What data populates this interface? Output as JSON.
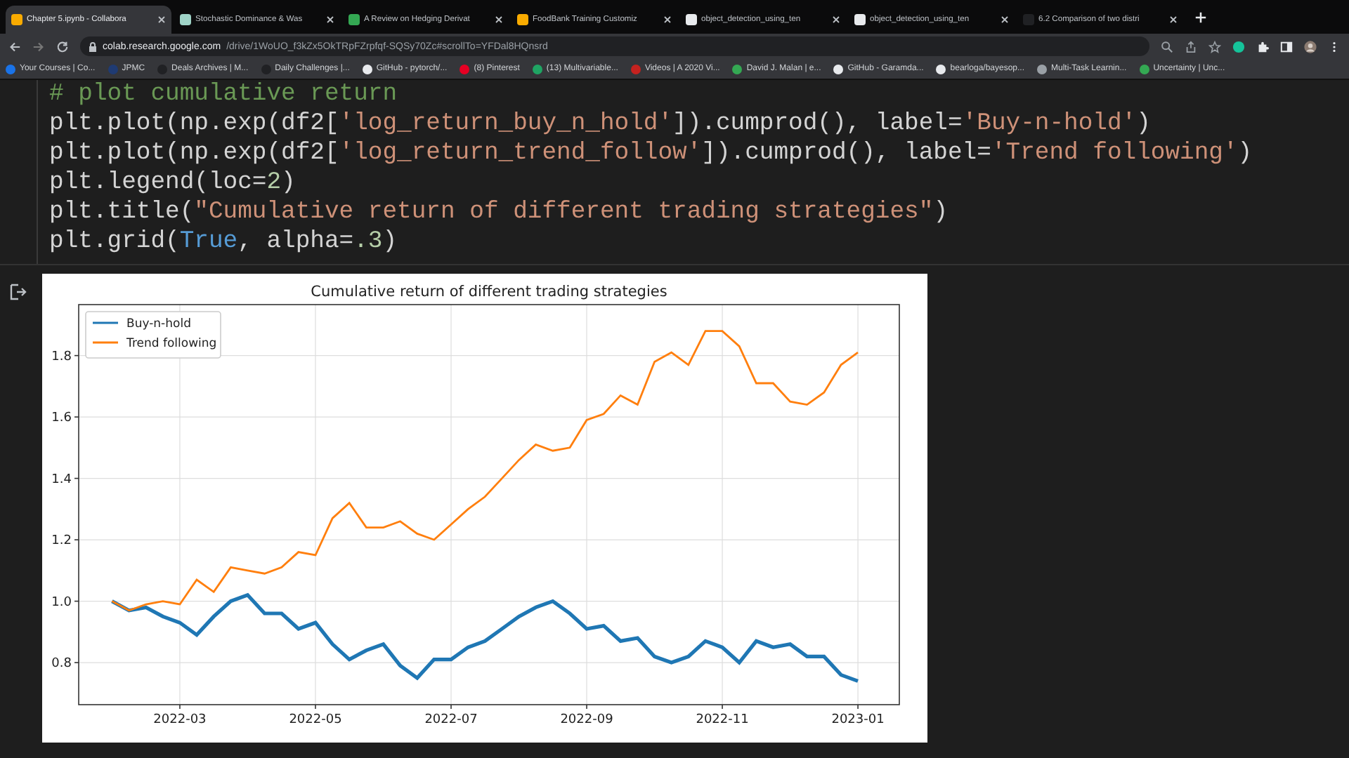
{
  "tabs": [
    {
      "title": "Chapter 5.ipynb - Collabora",
      "selected": true,
      "color": "#f9ab00"
    },
    {
      "title": "Stochastic Dominance & Was",
      "selected": false,
      "color": "#9fd3c7"
    },
    {
      "title": "A Review on Hedging Derivat",
      "selected": false,
      "color": "#34a853"
    },
    {
      "title": "FoodBank Training Customiz",
      "selected": false,
      "color": "#f9ab00"
    },
    {
      "title": "object_detection_using_ten",
      "selected": false,
      "color": "#e8eaed"
    },
    {
      "title": "object_detection_using_ten",
      "selected": false,
      "color": "#e8eaed"
    },
    {
      "title": "6.2 Comparison of two distri",
      "selected": false,
      "color": "#202124"
    }
  ],
  "address": {
    "host": "colab.research.google.com",
    "path": "/drive/1WoUO_f3kZx5OkTRpFZrpfqf-SQSy70Zc#scrollTo=YFDal8HQnsrd"
  },
  "bookmarks": [
    {
      "label": "Your Courses | Co...",
      "color": "#1a73e8"
    },
    {
      "label": "JPMC",
      "color": "#1f3b73"
    },
    {
      "label": "Deals Archives | M...",
      "color": "#202124"
    },
    {
      "label": "Daily Challenges |...",
      "color": "#202124"
    },
    {
      "label": "GitHub - pytorch/...",
      "color": "#e8eaed"
    },
    {
      "label": "(8) Pinterest",
      "color": "#e60023"
    },
    {
      "label": "(13) Multivariable...",
      "color": "#1fa463"
    },
    {
      "label": "Videos | A 2020 Vi...",
      "color": "#c5221f"
    },
    {
      "label": "David J. Malan | e...",
      "color": "#34a853"
    },
    {
      "label": "GitHub - Garamda...",
      "color": "#e8eaed"
    },
    {
      "label": "bearloga/bayesop...",
      "color": "#e8eaed"
    },
    {
      "label": "Multi-Task Learnin...",
      "color": "#9aa0a6"
    },
    {
      "label": "Uncertainty | Unc...",
      "color": "#34a853"
    }
  ],
  "code_lines": [
    [
      {
        "kind": "comment",
        "text": "# plot cumulative return"
      }
    ],
    [
      {
        "kind": "plain",
        "text": "plt.plot(np.exp(df2["
      },
      {
        "kind": "string",
        "text": "'log_return_buy_n_hold'"
      },
      {
        "kind": "plain",
        "text": "]).cumprod(), label="
      },
      {
        "kind": "string",
        "text": "'Buy-n-hold'"
      },
      {
        "kind": "plain",
        "text": ")"
      }
    ],
    [
      {
        "kind": "plain",
        "text": "plt.plot(np.exp(df2["
      },
      {
        "kind": "string",
        "text": "'log_return_trend_follow'"
      },
      {
        "kind": "plain",
        "text": "]).cumprod(), label="
      },
      {
        "kind": "string",
        "text": "'Trend following'"
      },
      {
        "kind": "plain",
        "text": ")"
      }
    ],
    [
      {
        "kind": "plain",
        "text": "plt.legend(loc="
      },
      {
        "kind": "number",
        "text": "2"
      },
      {
        "kind": "plain",
        "text": ")"
      }
    ],
    [
      {
        "kind": "plain",
        "text": "plt.title("
      },
      {
        "kind": "string",
        "text": "\"Cumulative return of different trading strategies\""
      },
      {
        "kind": "plain",
        "text": ")"
      }
    ],
    [
      {
        "kind": "plain",
        "text": "plt.grid("
      },
      {
        "kind": "keyword",
        "text": "True"
      },
      {
        "kind": "plain",
        "text": ", alpha="
      },
      {
        "kind": "number",
        "text": ".3"
      },
      {
        "kind": "plain",
        "text": ")"
      }
    ]
  ],
  "chart_data": {
    "type": "line",
    "title": "Cumulative return of different trading strategies",
    "categories": [
      null,
      null,
      null,
      null,
      "2022-03",
      null,
      null,
      null,
      null,
      null,
      null,
      null,
      "2022-05",
      null,
      null,
      null,
      null,
      null,
      null,
      null,
      "2022-07",
      null,
      null,
      null,
      null,
      null,
      null,
      null,
      "2022-09",
      null,
      null,
      null,
      null,
      null,
      null,
      null,
      "2022-11",
      null,
      null,
      null,
      null,
      null,
      null,
      null,
      "2023-01"
    ],
    "series": [
      {
        "name": "Buy-n-hold",
        "color": "#1f77b4",
        "values": [
          1.0,
          0.97,
          0.98,
          0.95,
          0.93,
          0.89,
          0.95,
          1.0,
          1.02,
          0.96,
          0.96,
          0.91,
          0.93,
          0.86,
          0.81,
          0.84,
          0.86,
          0.79,
          0.75,
          0.81,
          0.81,
          0.85,
          0.87,
          0.91,
          0.95,
          0.98,
          1.0,
          0.96,
          0.91,
          0.92,
          0.87,
          0.88,
          0.82,
          0.8,
          0.82,
          0.87,
          0.85,
          0.8,
          0.87,
          0.85,
          0.86,
          0.82,
          0.82,
          0.76,
          0.74
        ]
      },
      {
        "name": "Trend following",
        "color": "#ff7f0e",
        "values": [
          1.0,
          0.97,
          0.99,
          1.0,
          0.99,
          1.07,
          1.03,
          1.11,
          1.1,
          1.09,
          1.11,
          1.16,
          1.15,
          1.27,
          1.32,
          1.24,
          1.24,
          1.26,
          1.22,
          1.2,
          1.25,
          1.3,
          1.34,
          1.4,
          1.46,
          1.51,
          1.49,
          1.5,
          1.59,
          1.61,
          1.67,
          1.64,
          1.78,
          1.81,
          1.77,
          1.88,
          1.88,
          1.83,
          1.71,
          1.71,
          1.65,
          1.64,
          1.68,
          1.77,
          1.81
        ]
      }
    ],
    "ylim": [
      0.663,
      1.966
    ],
    "grid": true,
    "legend": true,
    "yticks": [
      {
        "value": 0.8,
        "label": "0.8"
      },
      {
        "value": 1.0,
        "label": "1.0"
      },
      {
        "value": 1.2,
        "label": "1.2"
      },
      {
        "value": 1.4,
        "label": "1.4"
      },
      {
        "value": 1.6,
        "label": "1.6"
      },
      {
        "value": 1.8,
        "label": "1.8"
      }
    ]
  }
}
